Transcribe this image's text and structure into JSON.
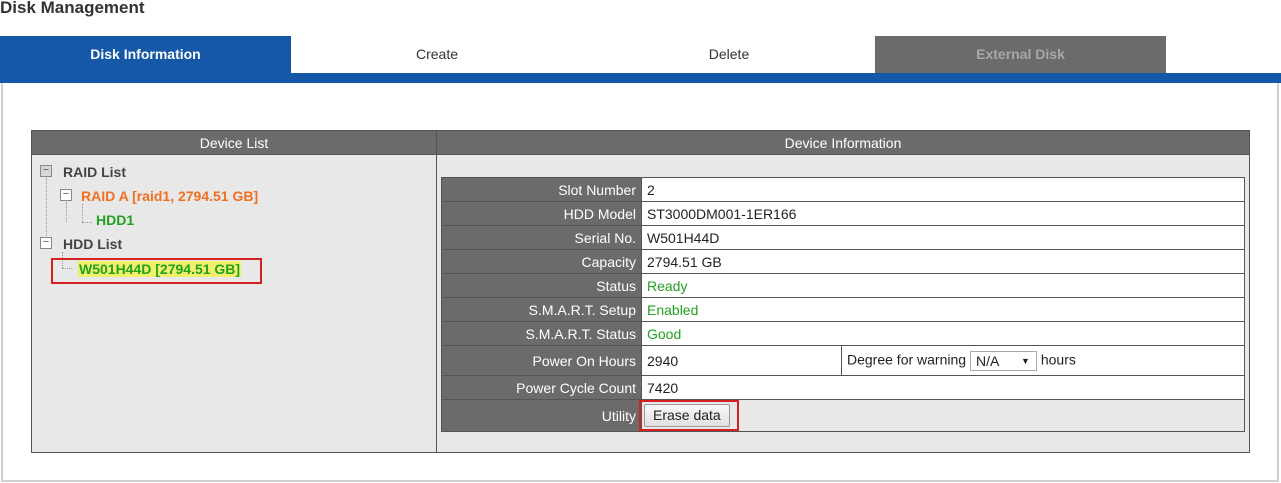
{
  "page": {
    "title": "Disk Management"
  },
  "tabs": [
    {
      "label": "Disk Information",
      "state": "active"
    },
    {
      "label": "Create",
      "state": "normal"
    },
    {
      "label": "Delete",
      "state": "normal"
    },
    {
      "label": "External Disk",
      "state": "disabled"
    }
  ],
  "device_list": {
    "header": "Device List",
    "raid_list_label": "RAID List",
    "raid_a_label": "RAID A [raid1, 2794.51 GB]",
    "hdd1_label": "HDD1",
    "hdd_list_label": "HDD List",
    "selected_disk_label": "W501H44D [2794.51 GB]"
  },
  "device_info": {
    "header": "Device Information",
    "slot_number": {
      "label": "Slot Number",
      "value": "2"
    },
    "hdd_model": {
      "label": "HDD Model",
      "value": "ST3000DM001-1ER166"
    },
    "serial_no": {
      "label": "Serial No.",
      "value": "W501H44D"
    },
    "capacity": {
      "label": "Capacity",
      "value": "2794.51 GB"
    },
    "status": {
      "label": "Status",
      "value": "Ready"
    },
    "smart_setup": {
      "label": "S.M.A.R.T. Setup",
      "value": "Enabled"
    },
    "smart_status": {
      "label": "S.M.A.R.T. Status",
      "value": "Good"
    },
    "power_on_hours": {
      "label": "Power On Hours",
      "value": "2940",
      "warning_label": "Degree for warning",
      "warning_value": "N/A",
      "warning_unit": "hours"
    },
    "power_cycle_count": {
      "label": "Power Cycle Count",
      "value": "7420"
    },
    "utility": {
      "label": "Utility",
      "button_label": "Erase data"
    }
  },
  "colors": {
    "accent_blue": "#1558a8",
    "header_gray": "#6b6b6b",
    "raid_orange": "#f07020",
    "ok_green": "#22a020",
    "highlight_red": "#d62020",
    "selected_yellow": "#f0f06a"
  },
  "icons": {
    "tree_toggle": "minus-box-icon",
    "select_arrow": "triangle-down-icon"
  }
}
